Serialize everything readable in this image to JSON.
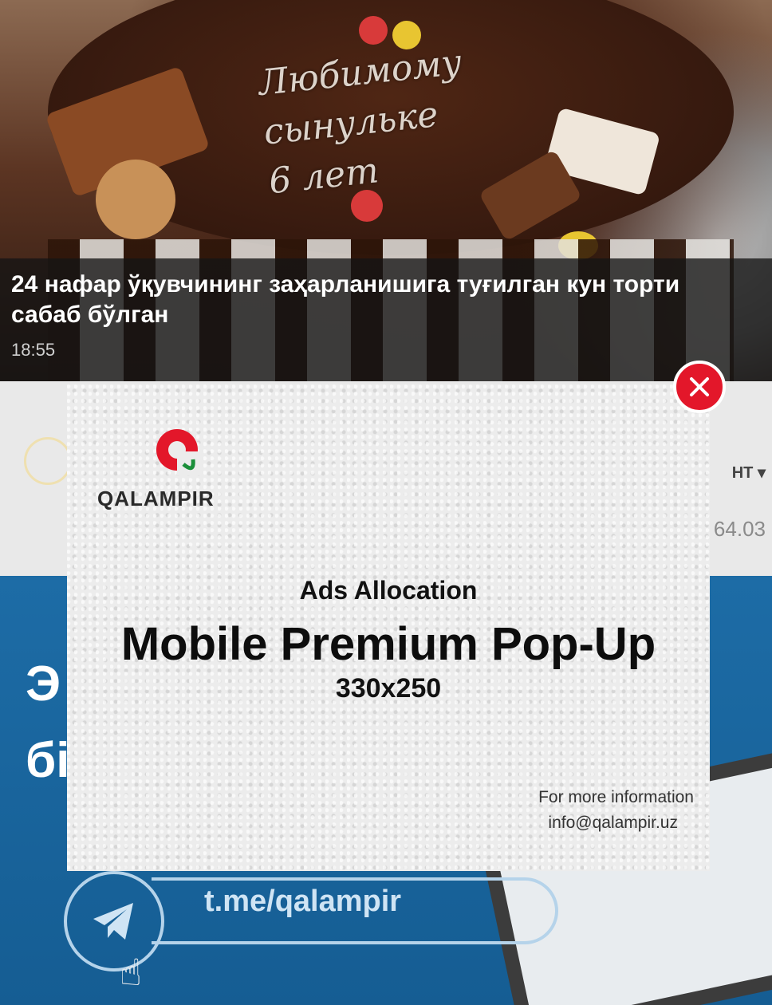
{
  "article": {
    "title": "24 нафар ўқувчининг заҳарланишига туғилган кун торти сабаб бўлган",
    "time": "18:55"
  },
  "cake_inscription": {
    "line1": "Любимому",
    "line2": "сынульке",
    "line3": "6 лет"
  },
  "info_strip": {
    "currency_label": "НТ ▾",
    "rate_value": "64.03"
  },
  "promo": {
    "line1": "Э",
    "line2": "бі",
    "telegram_link": "t.me/qalampir"
  },
  "popup": {
    "logo_text": "QALAMPIR",
    "ads_label": "Ads Allocation",
    "title": "Mobile Premium Pop-Up",
    "size": "330x250",
    "info_line1": "For more information",
    "info_line2": "info@qalampir.uz"
  },
  "colors": {
    "close_red": "#e3172a",
    "brand_red": "#e3172a",
    "promo_blue": "#1d6ca6"
  }
}
